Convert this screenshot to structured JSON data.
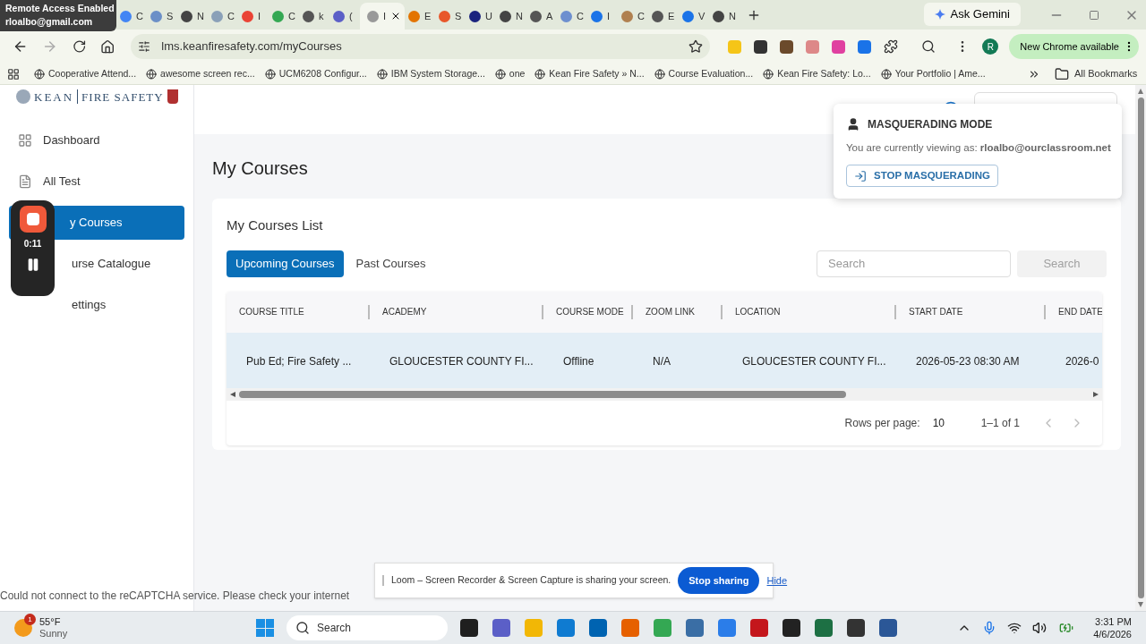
{
  "remote_access": {
    "title": "Remote Access Enabled",
    "account": "rloalbo@gmail.com"
  },
  "browser_tabs": [
    {
      "title": "C",
      "selected": false
    },
    {
      "title": "S",
      "selected": false
    },
    {
      "title": "N",
      "selected": false
    },
    {
      "title": "C",
      "selected": false
    },
    {
      "title": "I",
      "selected": false
    },
    {
      "title": "C",
      "selected": false
    },
    {
      "title": "k",
      "selected": false
    },
    {
      "title": "(",
      "selected": false
    },
    {
      "title": "I",
      "selected": true
    },
    {
      "title": "E",
      "selected": false
    },
    {
      "title": "S",
      "selected": false
    },
    {
      "title": "U",
      "selected": false
    },
    {
      "title": "N",
      "selected": false
    },
    {
      "title": "A",
      "selected": false
    },
    {
      "title": "C",
      "selected": false
    },
    {
      "title": "I",
      "selected": false
    },
    {
      "title": "C",
      "selected": false
    },
    {
      "title": "E",
      "selected": false
    },
    {
      "title": "V",
      "selected": false
    },
    {
      "title": "N",
      "selected": false
    }
  ],
  "ask_gemini": "Ask Gemini",
  "address": "lms.keanfiresafety.com/myCourses",
  "profile_initial": "R",
  "update_button": "New Chrome available",
  "bookmarks": [
    "Cooperative Attend...",
    "awesome screen rec...",
    "UCM6208 Configur...",
    "IBM System Storage...",
    "one",
    "Kean Fire Safety » N...",
    "Course Evaluation...",
    "Kean Fire Safety: Lo...",
    "Your Portfolio | Ame..."
  ],
  "all_bookmarks": "All Bookmarks",
  "logo": {
    "left": "KEAN",
    "right": "FIRE SAFETY"
  },
  "sidebar": [
    {
      "label": "Dashboard",
      "selected": false
    },
    {
      "label": "All Test",
      "selected": false
    },
    {
      "label": "y Courses",
      "selected": true
    },
    {
      "label": "urse Catalogue",
      "selected": false
    },
    {
      "label": "ettings",
      "selected": false
    }
  ],
  "loom_recorder": {
    "time": "0:11"
  },
  "page_title": "My Courses",
  "card_title": "My Courses List",
  "course_tabs": [
    {
      "label": "Upcoming Courses",
      "selected": true
    },
    {
      "label": "Past Courses",
      "selected": false
    }
  ],
  "search": {
    "placeholder": "Search",
    "button": "Search",
    "disabled": true
  },
  "table": {
    "columns": [
      "COURSE TITLE",
      "ACADEMY",
      "COURSE MODE",
      "ZOOM LINK",
      "LOCATION",
      "START DATE",
      "END DATE"
    ],
    "rows": [
      [
        "Pub Ed; Fire Safety ...",
        "GLOUCESTER COUNTY FI...",
        "Offline",
        "N/A",
        "GLOUCESTER COUNTY FI...",
        "2026-05-23 08:30 AM",
        "2026-0"
      ]
    ]
  },
  "pagination": {
    "rows_label": "Rows per page:",
    "rows_value": "10",
    "range": "1–1 of 1"
  },
  "masquerade": {
    "title": "MASQUERADING MODE",
    "message": "You are currently viewing as: **rloalbo@ourclassroom.net**",
    "button": "STOP MASQUERADING"
  },
  "recaptcha_error": "Could not connect to the reCAPTCHA service. Please check your internet",
  "loom_share": {
    "message": "Loom – Screen Recorder & Screen Capture is sharing your screen.",
    "stop": "Stop sharing",
    "hide": "Hide"
  },
  "taskbar": {
    "weather_badge": "1",
    "temperature": "55°F",
    "condition": "Sunny",
    "search": "Search",
    "time": "3:31 PM",
    "date": "4/6/2026"
  }
}
